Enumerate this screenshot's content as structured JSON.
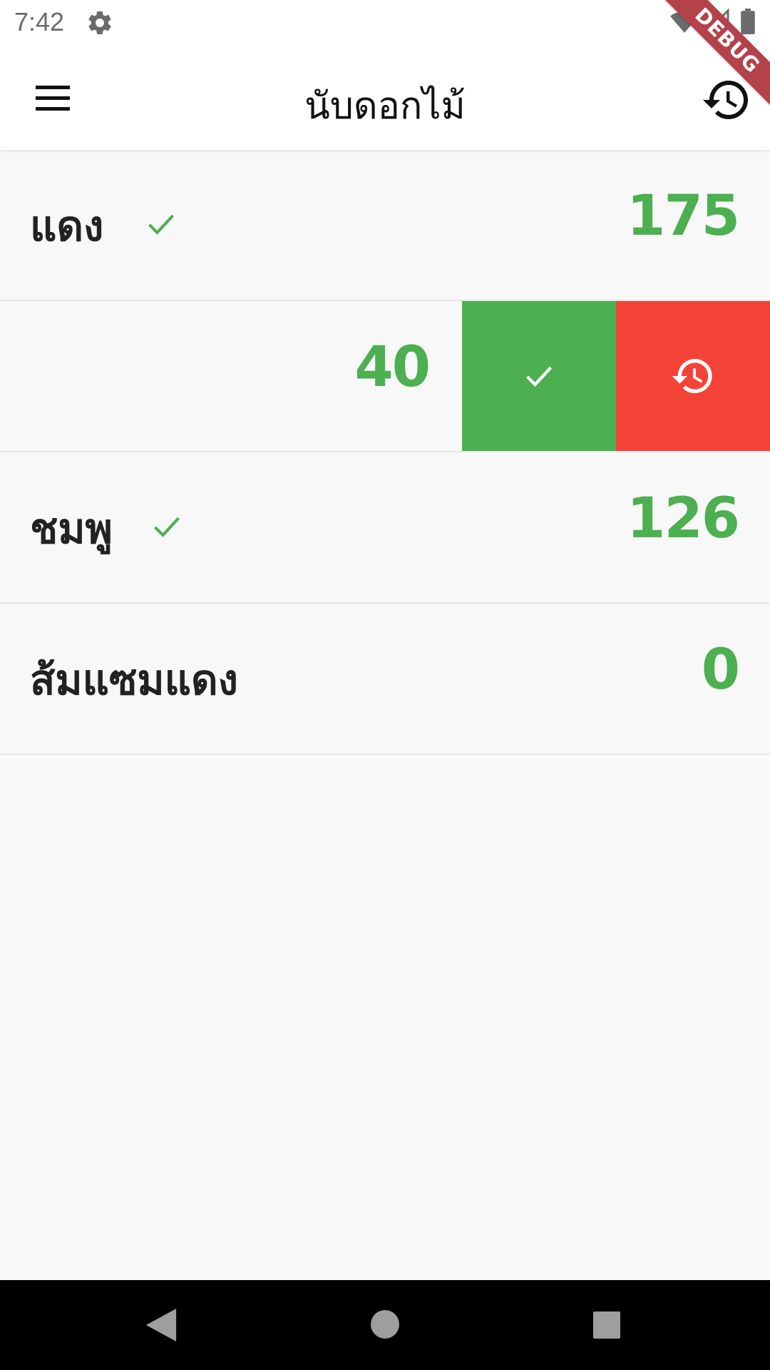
{
  "status_bar": {
    "time": "7:42",
    "icons": [
      "gear-icon",
      "wifi-icon",
      "signal-icon",
      "battery-icon"
    ]
  },
  "debug_banner": "DEBUG",
  "app_bar": {
    "title": "นับดอกไม้",
    "left_icon": "menu-icon",
    "right_icon": "history-icon"
  },
  "rows": [
    {
      "name": "แดง",
      "count": "175",
      "checked": true
    },
    {
      "name": "",
      "count": "40",
      "checked": false,
      "swiped": true,
      "actions": [
        "check-icon",
        "history-icon"
      ]
    },
    {
      "name": "ชมพู",
      "count": "126",
      "checked": true
    },
    {
      "name": "ส้มแซมแดง",
      "count": "0",
      "checked": false
    }
  ],
  "colors": {
    "accent_green": "#4caf50",
    "action_red": "#f44336",
    "debug_ribbon": "#b4424b"
  },
  "nav_bar": {
    "icons": [
      "back-icon",
      "home-icon",
      "recents-icon"
    ]
  }
}
